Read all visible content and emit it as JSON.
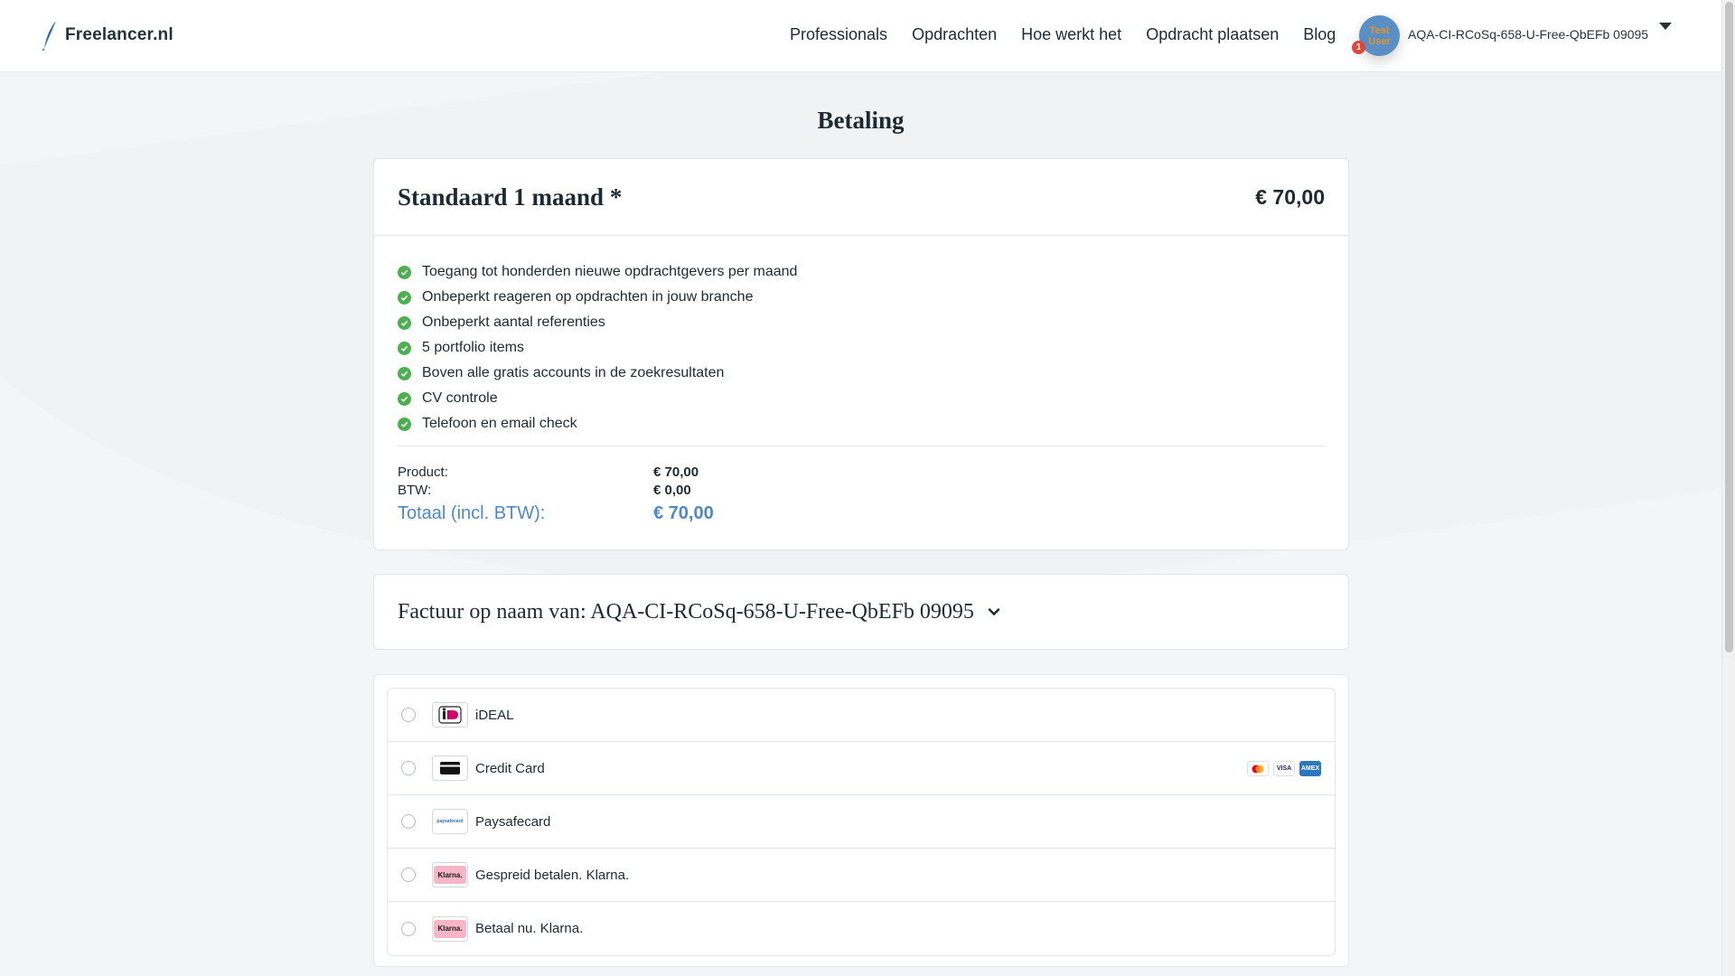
{
  "header": {
    "logo_text": "Freelancer.nl",
    "nav": [
      "Professionals",
      "Opdrachten",
      "Hoe werkt het",
      "Opdracht plaatsen",
      "Blog"
    ],
    "user": {
      "avatar_text": "Test User",
      "notification_count": "1",
      "name": "AQA-CI-RCoSq-658-U-Free-QbEFb 09095"
    }
  },
  "page": {
    "title": "Betaling"
  },
  "plan": {
    "name": "Standaard 1 maand *",
    "price": "€ 70,00",
    "features": [
      "Toegang tot honderden nieuwe opdrachtgevers per maand",
      "Onbeperkt reageren op opdrachten in jouw branche",
      "Onbeperkt aantal referenties",
      "5 portfolio items",
      "Boven alle gratis accounts in de zoekresultaten",
      "CV controle",
      "Telefoon en email check"
    ],
    "summary": {
      "product_label": "Product:",
      "product_value": "€ 70,00",
      "btw_label": "BTW:",
      "btw_value": "€ 0,00",
      "total_label": "Totaal (incl. BTW):",
      "total_value": "€ 70,00"
    }
  },
  "invoice": {
    "label": "Factuur op naam van: AQA-CI-RCoSq-658-U-Free-QbEFb 09095"
  },
  "payment_methods": [
    {
      "label": "iDEAL",
      "icon": "ideal-icon"
    },
    {
      "label": "Credit Card",
      "icon": "credit-card-icon",
      "brands": [
        "MC",
        "VISA",
        "AMEX"
      ]
    },
    {
      "label": "Paysafecard",
      "icon": "paysafecard-icon",
      "badge": "paysafecard"
    },
    {
      "label": "Gespreid betalen. Klarna.",
      "icon": "klarna-icon",
      "badge": "Klarna."
    },
    {
      "label": "Betaal nu. Klarna.",
      "icon": "klarna-icon",
      "badge": "Klarna."
    }
  ],
  "colors": {
    "accent": "#4f88c6",
    "check": "#4caf50",
    "notification": "#e0473a",
    "klarna": "#f6b6c8"
  }
}
